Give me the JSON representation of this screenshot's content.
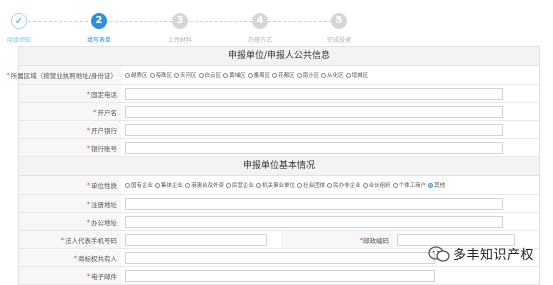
{
  "stepper": {
    "steps": [
      {
        "num": "✓",
        "label": "阅读须知",
        "state": "done"
      },
      {
        "num": "2",
        "label": "填写表单",
        "state": "active"
      },
      {
        "num": "3",
        "label": "上传材料",
        "state": "todo"
      },
      {
        "num": "4",
        "label": "办理方式",
        "state": "todo"
      },
      {
        "num": "5",
        "label": "完成投递",
        "state": "todo"
      }
    ]
  },
  "section1": {
    "title": "申报单位/申报人公共信息",
    "region_label": "所属区域（按营业执照地址/身份证）",
    "region_options": [
      "越秀区",
      "海珠区",
      "天河区",
      "白云区",
      "黄埔区",
      "番禺区",
      "花都区",
      "南沙区",
      "从化区",
      "增城区"
    ],
    "phone_label": "固定电话",
    "account_name_label": "开户名",
    "bank_label": "开户银行",
    "bank_account_label": "银行账号"
  },
  "section2": {
    "title": "申报单位基本情况",
    "nature_label": "单位性质",
    "nature_options": [
      "国有企业",
      "集体企业",
      "港澳台及外资",
      "民营企业",
      "机关事业单位",
      "社会团体",
      "民办非企业",
      "合伙组织",
      "个体工商户",
      "其他"
    ],
    "nature_selected_index": 9,
    "reg_address_label": "注册地址",
    "office_address_label": "办公地址",
    "legal_phone_label": "法人代表手机号码",
    "postcode_label": "邮政编码",
    "trademark_owner_label": "商标权共有人",
    "email_label": "电子邮件"
  },
  "watermark": {
    "text": "多丰知识产权"
  },
  "colors": {
    "accent": "#2d8fe2",
    "required": "#e4393c"
  }
}
